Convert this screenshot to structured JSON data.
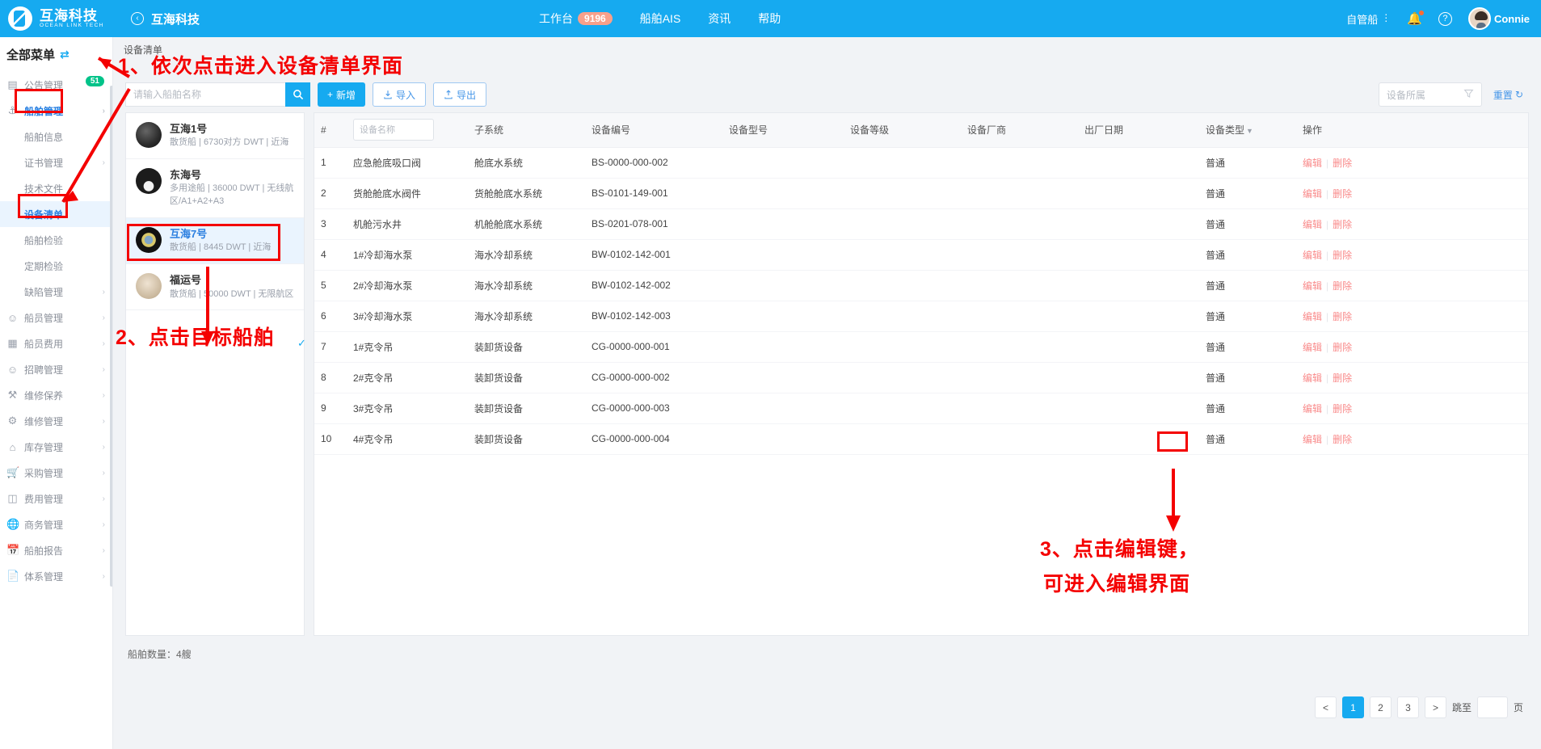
{
  "topbar": {
    "brand_cn": "互海科技",
    "brand_en": "OCEAN LINK TECH",
    "back_title": "互海科技",
    "nav": [
      {
        "label": "工作台",
        "badge": "9196"
      },
      {
        "label": "船舶AIS",
        "badge": ""
      },
      {
        "label": "资讯",
        "badge": ""
      },
      {
        "label": "帮助",
        "badge": ""
      }
    ],
    "fleet_label": "自管船",
    "username": "Connie"
  },
  "sidebar": {
    "title": "全部菜单",
    "items": [
      {
        "label": "公告管理",
        "icon": "announcement-icon",
        "badge": "51",
        "sub": false,
        "chevron": false,
        "state": ""
      },
      {
        "label": "船舶管理",
        "icon": "anchor-icon",
        "badge": "",
        "sub": false,
        "chevron": true,
        "state": "active-blue"
      },
      {
        "label": "船舶信息",
        "icon": "",
        "badge": "",
        "sub": true,
        "chevron": false,
        "state": ""
      },
      {
        "label": "证书管理",
        "icon": "",
        "badge": "",
        "sub": true,
        "chevron": true,
        "state": ""
      },
      {
        "label": "技术文件",
        "icon": "",
        "badge": "",
        "sub": true,
        "chevron": false,
        "state": ""
      },
      {
        "label": "设备清单",
        "icon": "",
        "badge": "",
        "sub": true,
        "chevron": false,
        "state": "selected"
      },
      {
        "label": "船舶检验",
        "icon": "",
        "badge": "",
        "sub": true,
        "chevron": false,
        "state": ""
      },
      {
        "label": "定期检验",
        "icon": "",
        "badge": "",
        "sub": true,
        "chevron": false,
        "state": ""
      },
      {
        "label": "缺陷管理",
        "icon": "",
        "badge": "",
        "sub": true,
        "chevron": true,
        "state": ""
      },
      {
        "label": "船员管理",
        "icon": "person-icon",
        "badge": "",
        "sub": false,
        "chevron": true,
        "state": ""
      },
      {
        "label": "船员费用",
        "icon": "card-icon",
        "badge": "",
        "sub": false,
        "chevron": true,
        "state": ""
      },
      {
        "label": "招聘管理",
        "icon": "person-add-icon",
        "badge": "",
        "sub": false,
        "chevron": true,
        "state": ""
      },
      {
        "label": "维修保养",
        "icon": "tool-icon",
        "badge": "",
        "sub": false,
        "chevron": true,
        "state": ""
      },
      {
        "label": "维修管理",
        "icon": "wrench-icon",
        "badge": "",
        "sub": false,
        "chevron": true,
        "state": ""
      },
      {
        "label": "库存管理",
        "icon": "warehouse-icon",
        "badge": "",
        "sub": false,
        "chevron": true,
        "state": ""
      },
      {
        "label": "采购管理",
        "icon": "cart-icon",
        "badge": "",
        "sub": false,
        "chevron": true,
        "state": ""
      },
      {
        "label": "费用管理",
        "icon": "database-icon",
        "badge": "",
        "sub": false,
        "chevron": true,
        "state": ""
      },
      {
        "label": "商务管理",
        "icon": "globe-icon",
        "badge": "",
        "sub": false,
        "chevron": true,
        "state": ""
      },
      {
        "label": "船舶报告",
        "icon": "calendar-icon",
        "badge": "",
        "sub": false,
        "chevron": true,
        "state": ""
      },
      {
        "label": "体系管理",
        "icon": "copy-icon",
        "badge": "",
        "sub": false,
        "chevron": true,
        "state": ""
      }
    ]
  },
  "breadcrumb": "设备清单",
  "toolbar": {
    "search_placeholder": "请输入船舶名称",
    "search_value": "",
    "add_label": "新增",
    "import_label": "导入",
    "export_label": "导出",
    "filter_placeholder": "设备所属",
    "reset_label": "重置"
  },
  "ships": {
    "count_label": "船舶数量：4艘",
    "items": [
      {
        "name": "互海1号",
        "meta": "散货船 | 6730对方 DWT | 近海",
        "selected": false,
        "avatar": "a1"
      },
      {
        "name": "东海号",
        "meta": "多用途船 | 36000 DWT | 无线航区/A1+A2+A3",
        "selected": false,
        "avatar": "a2"
      },
      {
        "name": "互海7号",
        "meta": "散货船 | 8445 DWT | 近海",
        "selected": true,
        "avatar": "a3"
      },
      {
        "name": "福运号",
        "meta": "散货船 | 50000 DWT | 无限航区",
        "selected": false,
        "avatar": "a4"
      }
    ]
  },
  "table": {
    "columns": [
      {
        "key": "idx",
        "label": "#",
        "type": "text"
      },
      {
        "key": "name",
        "label": "",
        "type": "input",
        "placeholder": "设备名称"
      },
      {
        "key": "subsystem",
        "label": "子系统",
        "type": "text"
      },
      {
        "key": "code",
        "label": "设备编号",
        "type": "text"
      },
      {
        "key": "model",
        "label": "设备型号",
        "type": "text"
      },
      {
        "key": "grade",
        "label": "设备等级",
        "type": "text"
      },
      {
        "key": "vendor",
        "label": "设备厂商",
        "type": "text"
      },
      {
        "key": "mfg_date",
        "label": "出厂日期",
        "type": "text"
      },
      {
        "key": "type",
        "label": "设备类型",
        "type": "sortable"
      },
      {
        "key": "op",
        "label": "操作",
        "type": "text"
      }
    ],
    "rows": [
      {
        "idx": "1",
        "name": "应急舱底吸口阀",
        "subsystem": "舱底水系统",
        "code": "BS-0000-000-002",
        "model": "",
        "grade": "",
        "vendor": "",
        "mfg_date": "",
        "type": "普通"
      },
      {
        "idx": "2",
        "name": "货舱舱底水阀件",
        "subsystem": "货舱舱底水系统",
        "code": "BS-0101-149-001",
        "model": "",
        "grade": "",
        "vendor": "",
        "mfg_date": "",
        "type": "普通"
      },
      {
        "idx": "3",
        "name": "机舱污水井",
        "subsystem": "机舱舱底水系统",
        "code": "BS-0201-078-001",
        "model": "",
        "grade": "",
        "vendor": "",
        "mfg_date": "",
        "type": "普通"
      },
      {
        "idx": "4",
        "name": "1#冷却海水泵",
        "subsystem": "海水冷却系统",
        "code": "BW-0102-142-001",
        "model": "",
        "grade": "",
        "vendor": "",
        "mfg_date": "",
        "type": "普通"
      },
      {
        "idx": "5",
        "name": "2#冷却海水泵",
        "subsystem": "海水冷却系统",
        "code": "BW-0102-142-002",
        "model": "",
        "grade": "",
        "vendor": "",
        "mfg_date": "",
        "type": "普通"
      },
      {
        "idx": "6",
        "name": "3#冷却海水泵",
        "subsystem": "海水冷却系统",
        "code": "BW-0102-142-003",
        "model": "",
        "grade": "",
        "vendor": "",
        "mfg_date": "",
        "type": "普通"
      },
      {
        "idx": "7",
        "name": "1#克令吊",
        "subsystem": "装卸货设备",
        "code": "CG-0000-000-001",
        "model": "",
        "grade": "",
        "vendor": "",
        "mfg_date": "",
        "type": "普通"
      },
      {
        "idx": "8",
        "name": "2#克令吊",
        "subsystem": "装卸货设备",
        "code": "CG-0000-000-002",
        "model": "",
        "grade": "",
        "vendor": "",
        "mfg_date": "",
        "type": "普通"
      },
      {
        "idx": "9",
        "name": "3#克令吊",
        "subsystem": "装卸货设备",
        "code": "CG-0000-000-003",
        "model": "",
        "grade": "",
        "vendor": "",
        "mfg_date": "",
        "type": "普通"
      },
      {
        "idx": "10",
        "name": "4#克令吊",
        "subsystem": "装卸货设备",
        "code": "CG-0000-000-004",
        "model": "",
        "grade": "",
        "vendor": "",
        "mfg_date": "",
        "type": "普通"
      }
    ],
    "edit_label": "编辑",
    "delete_label": "删除"
  },
  "pagination": {
    "prev": "<",
    "pages": [
      "1",
      "2",
      "3"
    ],
    "active": "1",
    "next": ">",
    "jump_label": "跳至",
    "jump_value": "",
    "page_unit": "页"
  },
  "annotations": {
    "step1": "1、依次点击进入设备清单界面",
    "step2": "2、点击目标船舶",
    "step3_line1": "3、点击编辑键，",
    "step3_line2": "可进入编辑界面"
  },
  "colors": {
    "brand_blue": "#16aaf0",
    "annotation_red": "#f40000",
    "badge_green": "#00c389",
    "badge_orange": "#f9a08a"
  }
}
